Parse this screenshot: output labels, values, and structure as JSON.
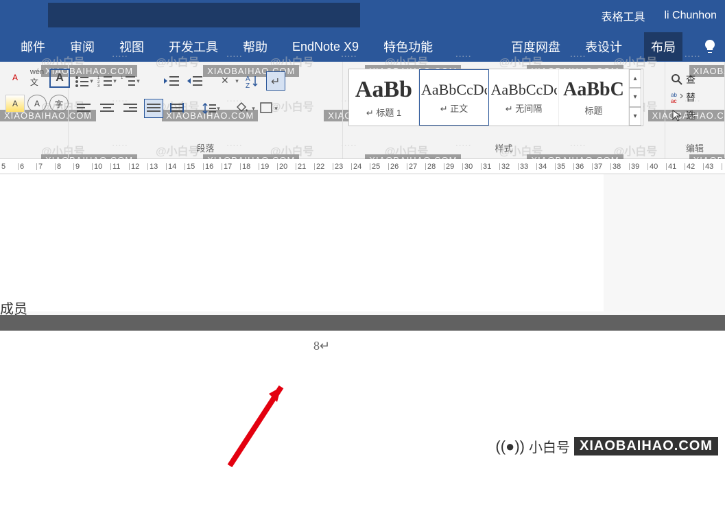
{
  "title_bar": {
    "table_tools": "表格工具",
    "user": "li Chunhon"
  },
  "menu": {
    "items": [
      "邮件",
      "审阅",
      "视图",
      "开发工具",
      "帮助",
      "EndNote X9",
      "特色功能",
      "百度网盘",
      "表设计",
      "布局"
    ]
  },
  "ribbon": {
    "font": {
      "wen": "wén",
      "a": "文",
      "a2": "A",
      "a3": "A",
      "a4": "字"
    },
    "paragraph_label": "段落",
    "styles_label": "样式",
    "edit_label": "编辑",
    "styles": [
      {
        "preview": "AaBb",
        "name": "标题 1",
        "big": true
      },
      {
        "preview": "AaBbCcDc",
        "name": "正文",
        "selected": true
      },
      {
        "preview": "AaBbCcDc",
        "name": "无间隔"
      },
      {
        "preview": "AaBbC",
        "name": "标题"
      }
    ],
    "edit": {
      "find": "查",
      "replace": "替",
      "select": "选"
    }
  },
  "ruler": {
    "start": 5,
    "end": 43
  },
  "doc": {
    "member": "成员",
    "page_marker": "8↵"
  },
  "watermark": {
    "text1": "@小白号",
    "text2": "XIAOBAIHAO.COM"
  },
  "bottom_logo": {
    "text": "小白号",
    "badge": "XIAOBAIHAO.COM"
  }
}
